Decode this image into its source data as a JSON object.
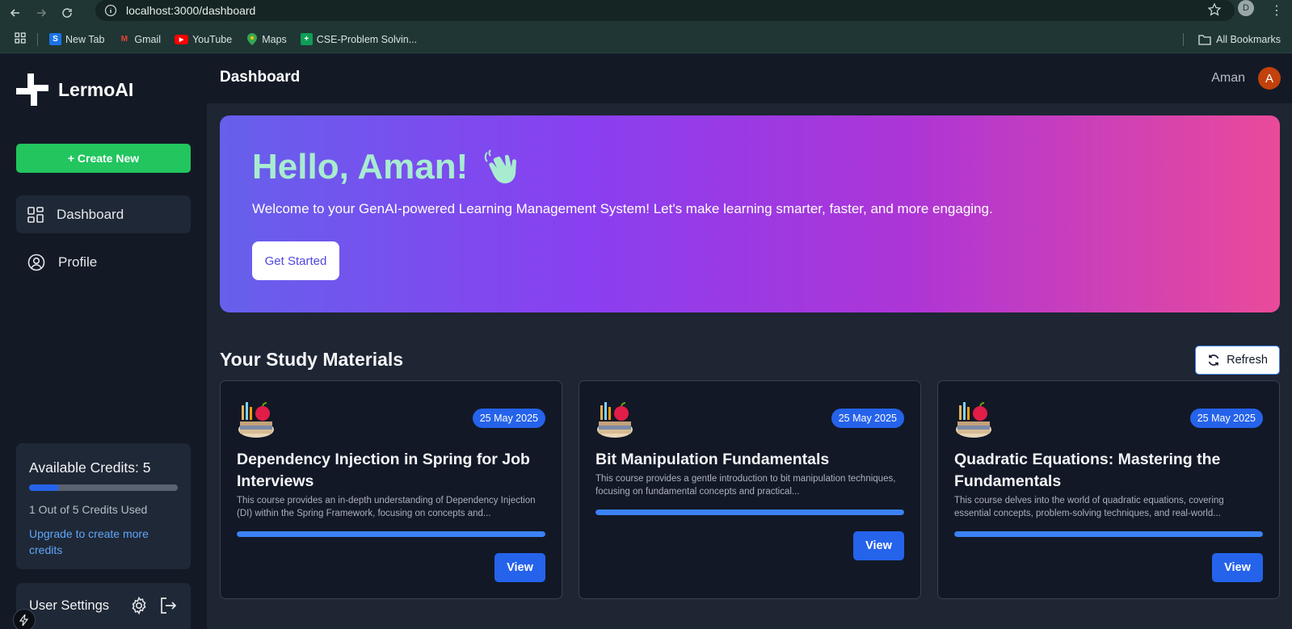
{
  "browser": {
    "url": "localhost:3000/dashboard",
    "profile_initial": "D",
    "bookmarks": [
      {
        "label": "New Tab",
        "icon": "new-tab-icon"
      },
      {
        "label": "Gmail",
        "icon": "gmail-icon"
      },
      {
        "label": "YouTube",
        "icon": "youtube-icon"
      },
      {
        "label": "Maps",
        "icon": "maps-icon"
      },
      {
        "label": "CSE-Problem Solvin...",
        "icon": "sheets-icon"
      }
    ],
    "all_bookmarks": "All Bookmarks"
  },
  "sidebar": {
    "brand": "LermoAI",
    "create_label": "+ Create New",
    "items": [
      {
        "label": "Dashboard",
        "icon": "grid-icon",
        "active": true
      },
      {
        "label": "Profile",
        "icon": "user-circle-icon",
        "active": false
      }
    ],
    "credits": {
      "title": "Available Credits: 5",
      "used_fraction": 0.2,
      "used_text": "1 Out of 5 Credits Used",
      "upgrade": "Upgrade to create more credits"
    },
    "settings_label": "User Settings"
  },
  "header": {
    "title": "Dashboard",
    "user_name": "Aman",
    "user_initial": "A"
  },
  "hero": {
    "greeting": "Hello, Aman!",
    "subtitle": "Welcome to your GenAI-powered Learning Management System! Let's make learning smarter, faster, and more engaging.",
    "cta": "Get Started"
  },
  "materials": {
    "title": "Your Study Materials",
    "refresh": "Refresh",
    "view_label": "View",
    "cards": [
      {
        "date": "25 May 2025",
        "title": "Dependency Injection in Spring for Job Interviews",
        "description": "This course provides an in-depth understanding of Dependency Injection (DI) within the Spring Framework, focusing on concepts and...",
        "progress": 1.0
      },
      {
        "date": "25 May 2025",
        "title": "Bit Manipulation Fundamentals",
        "description": "This course provides a gentle introduction to bit manipulation techniques, focusing on fundamental concepts and practical...",
        "progress": 1.0
      },
      {
        "date": "25 May 2025",
        "title": "Quadratic Equations: Mastering the Fundamentals",
        "description": "This course delves into the world of quadratic equations, covering essential concepts, problem-solving techniques, and real-world...",
        "progress": 1.0
      }
    ]
  }
}
